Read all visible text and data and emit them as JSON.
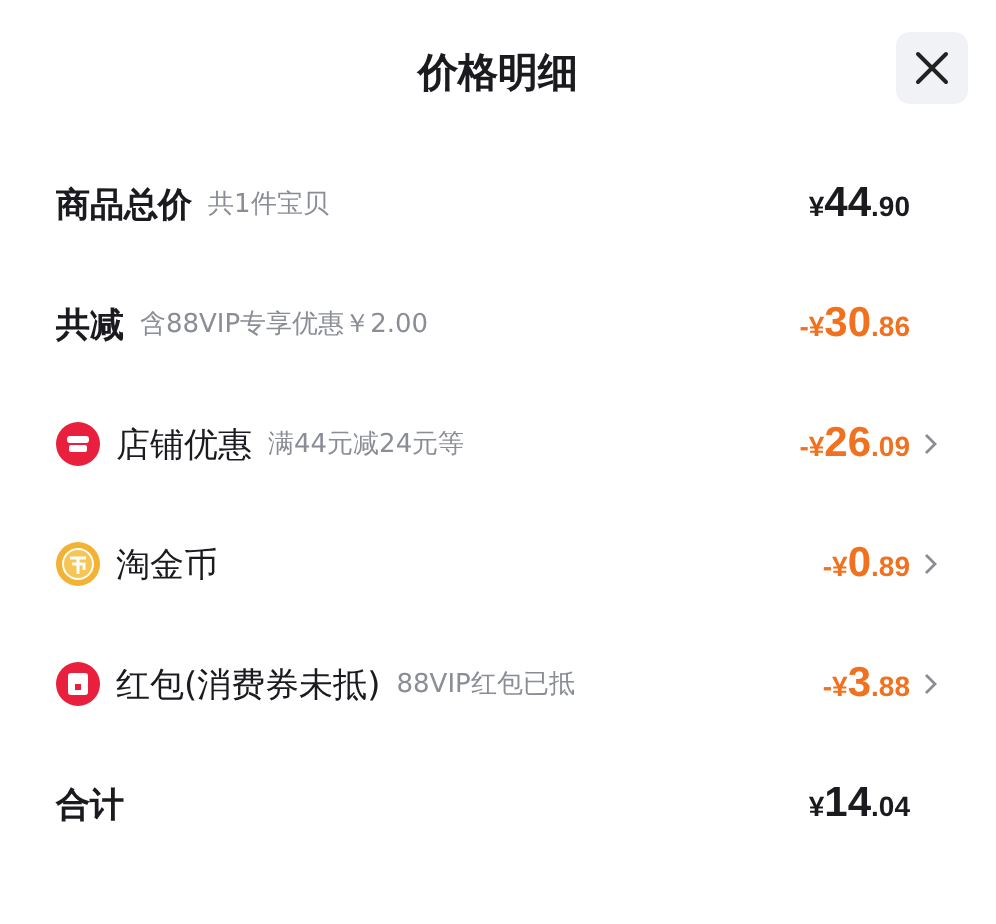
{
  "title": "价格明细",
  "rows": [
    {
      "kind": "plain",
      "label": "商品总价",
      "note": "共1件宝贝",
      "amount": {
        "negative": false,
        "currency": "¥",
        "whole": "44",
        "cents": ".90"
      },
      "has_detail": false
    },
    {
      "kind": "plain",
      "label": "共减",
      "note": "含88VIP专享优惠￥2.00",
      "amount": {
        "negative": true,
        "currency": "-¥",
        "whole": "30",
        "cents": ".86"
      },
      "has_detail": false
    },
    {
      "kind": "shop",
      "label": "店铺优惠",
      "note": "满44元减24元等",
      "amount": {
        "negative": true,
        "currency": "-¥",
        "whole": "26",
        "cents": ".09"
      },
      "has_detail": true
    },
    {
      "kind": "coin",
      "label": "淘金币",
      "amount": {
        "negative": true,
        "currency": "-¥",
        "whole": "0",
        "cents": ".89"
      },
      "has_detail": true
    },
    {
      "kind": "redpacket",
      "label": "红包(消费券未抵)",
      "note": "88VIP红包已抵",
      "amount": {
        "negative": true,
        "currency": "-¥",
        "whole": "3",
        "cents": ".88"
      },
      "has_detail": true
    },
    {
      "kind": "plain",
      "label": "合计",
      "amount": {
        "negative": false,
        "currency": "¥",
        "whole": "14",
        "cents": ".04"
      },
      "has_detail": false
    }
  ]
}
